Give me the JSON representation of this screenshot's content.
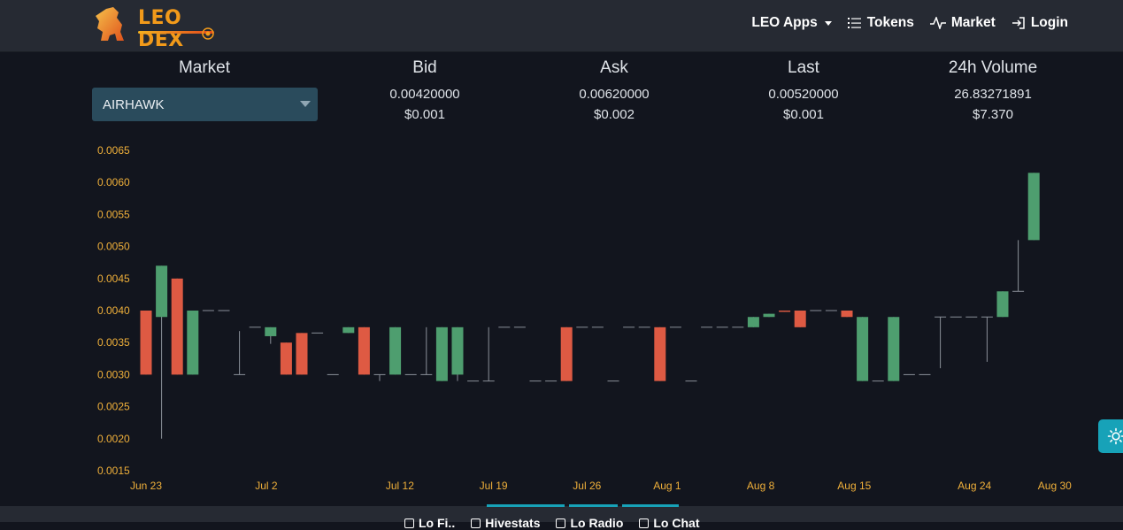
{
  "navbar": {
    "brand": "LEO DEX",
    "items": [
      {
        "label": "LEO Apps",
        "icon": "caret-down-icon"
      },
      {
        "label": "Tokens",
        "icon": "list-icon"
      },
      {
        "label": "Market",
        "icon": "activity-icon"
      },
      {
        "label": "Login",
        "icon": "login-icon"
      }
    ]
  },
  "stats": {
    "market": {
      "label": "Market",
      "selected": "AIRHAWK"
    },
    "bid": {
      "label": "Bid",
      "value": "0.00420000",
      "usd": "$0.001"
    },
    "ask": {
      "label": "Ask",
      "value": "0.00620000",
      "usd": "$0.002"
    },
    "last": {
      "label": "Last",
      "value": "0.00520000",
      "usd": "$0.001"
    },
    "volume": {
      "label": "24h Volume",
      "value": "26.83271891",
      "usd": "$7.370"
    }
  },
  "colors": {
    "up": "#4e9e6f",
    "down": "#de5a43",
    "axis_text": "#f0b03a",
    "accent": "#17a2b8"
  },
  "chart_data": {
    "type": "candlestick",
    "ylim": [
      0.0015,
      0.0065
    ],
    "y_ticks": [
      "0.0065",
      "0.0060",
      "0.0055",
      "0.0050",
      "0.0045",
      "0.0040",
      "0.0035",
      "0.0030",
      "0.0025",
      "0.0020",
      "0.0015"
    ],
    "x_ticks": [
      {
        "label": "Jun 23",
        "day": 0
      },
      {
        "label": "Jul 2",
        "day": 9
      },
      {
        "label": "Jul 12",
        "day": 19
      },
      {
        "label": "Jul 19",
        "day": 26
      },
      {
        "label": "Jul 26",
        "day": 33
      },
      {
        "label": "Aug 1",
        "day": 39
      },
      {
        "label": "Aug 8",
        "day": 46
      },
      {
        "label": "Aug 15",
        "day": 53
      },
      {
        "label": "Aug 24",
        "day": 62
      },
      {
        "label": "Aug 30",
        "day": 68
      }
    ],
    "candles": [
      {
        "date": "Jun 23",
        "open": 0.004,
        "close": 0.003,
        "high": 0.004,
        "low": 0.003
      },
      {
        "date": "Jun 24",
        "open": 0.0039,
        "close": 0.0047,
        "high": 0.0047,
        "low": 0.002
      },
      {
        "date": "Jun 25",
        "open": 0.0045,
        "close": 0.003,
        "high": 0.0045,
        "low": 0.003
      },
      {
        "date": "Jun 26",
        "open": 0.003,
        "close": 0.004,
        "high": 0.004,
        "low": 0.003
      },
      {
        "date": "Jun 27",
        "open": 0.004,
        "close": 0.004,
        "high": 0.004,
        "low": 0.004
      },
      {
        "date": "Jun 28",
        "open": 0.004,
        "close": 0.004,
        "high": 0.004,
        "low": 0.004
      },
      {
        "date": "Jun 29",
        "open": 0.003,
        "close": 0.003,
        "high": 0.00368,
        "low": 0.003
      },
      {
        "date": "Jun 30",
        "open": 0.00374,
        "close": 0.00374,
        "high": 0.00374,
        "low": 0.00374
      },
      {
        "date": "Jul 1",
        "open": 0.0036,
        "close": 0.00374,
        "high": 0.00374,
        "low": 0.00348
      },
      {
        "date": "Jul 2",
        "open": 0.0035,
        "close": 0.003,
        "high": 0.0035,
        "low": 0.003
      },
      {
        "date": "Jul 3",
        "open": 0.00365,
        "close": 0.003,
        "high": 0.00365,
        "low": 0.003
      },
      {
        "date": "Jul 4",
        "open": 0.00365,
        "close": 0.00365,
        "high": 0.00365,
        "low": 0.00365
      },
      {
        "date": "Jul 5",
        "open": 0.003,
        "close": 0.003,
        "high": 0.003,
        "low": 0.003
      },
      {
        "date": "Jul 6",
        "open": 0.00365,
        "close": 0.00374,
        "high": 0.00374,
        "low": 0.00365
      },
      {
        "date": "Jul 7",
        "open": 0.00374,
        "close": 0.003,
        "high": 0.00374,
        "low": 0.003
      },
      {
        "date": "Jul 8",
        "open": 0.003,
        "close": 0.003,
        "high": 0.003,
        "low": 0.0029
      },
      {
        "date": "Jul 9",
        "open": 0.003,
        "close": 0.00374,
        "high": 0.00374,
        "low": 0.003
      },
      {
        "date": "Jul 10",
        "open": 0.003,
        "close": 0.003,
        "high": 0.003,
        "low": 0.003
      },
      {
        "date": "Jul 11",
        "open": 0.003,
        "close": 0.003,
        "high": 0.00374,
        "low": 0.003
      },
      {
        "date": "Jul 12",
        "open": 0.0029,
        "close": 0.00374,
        "high": 0.00374,
        "low": 0.0029
      },
      {
        "date": "Jul 13",
        "open": 0.003,
        "close": 0.00374,
        "high": 0.00374,
        "low": 0.0029
      },
      {
        "date": "Jul 14",
        "open": 0.0029,
        "close": 0.0029,
        "high": 0.0029,
        "low": 0.0029
      },
      {
        "date": "Jul 15",
        "open": 0.0029,
        "close": 0.0029,
        "high": 0.00374,
        "low": 0.0029
      },
      {
        "date": "Jul 16",
        "open": 0.00374,
        "close": 0.00374,
        "high": 0.00374,
        "low": 0.00374
      },
      {
        "date": "Jul 17",
        "open": 0.00374,
        "close": 0.00374,
        "high": 0.00374,
        "low": 0.00374
      },
      {
        "date": "Jul 20",
        "open": 0.0029,
        "close": 0.0029,
        "high": 0.0029,
        "low": 0.0029
      },
      {
        "date": "Jul 21",
        "open": 0.0029,
        "close": 0.0029,
        "high": 0.0029,
        "low": 0.0029
      },
      {
        "date": "Jul 22",
        "open": 0.00374,
        "close": 0.0029,
        "high": 0.00374,
        "low": 0.0029
      },
      {
        "date": "Jul 23",
        "open": 0.00374,
        "close": 0.00374,
        "high": 0.00374,
        "low": 0.00374
      },
      {
        "date": "Jul 24",
        "open": 0.00374,
        "close": 0.00374,
        "high": 0.00374,
        "low": 0.00374
      },
      {
        "date": "Jul 26",
        "open": 0.0029,
        "close": 0.0029,
        "high": 0.0029,
        "low": 0.0029
      },
      {
        "date": "Jul 28",
        "open": 0.00374,
        "close": 0.00374,
        "high": 0.00374,
        "low": 0.00374
      },
      {
        "date": "Jul 29",
        "open": 0.00374,
        "close": 0.00374,
        "high": 0.00374,
        "low": 0.00374
      },
      {
        "date": "Jul 30",
        "open": 0.00374,
        "close": 0.0029,
        "high": 0.00374,
        "low": 0.0029
      },
      {
        "date": "Jul 31",
        "open": 0.00374,
        "close": 0.00374,
        "high": 0.00374,
        "low": 0.00374
      },
      {
        "date": "Aug 1",
        "open": 0.0029,
        "close": 0.0029,
        "high": 0.0029,
        "low": 0.0029
      },
      {
        "date": "Aug 3",
        "open": 0.00374,
        "close": 0.00374,
        "high": 0.00374,
        "low": 0.00374
      },
      {
        "date": "Aug 4",
        "open": 0.00374,
        "close": 0.00374,
        "high": 0.00374,
        "low": 0.00374
      },
      {
        "date": "Aug 5",
        "open": 0.00374,
        "close": 0.00374,
        "high": 0.00374,
        "low": 0.00374
      },
      {
        "date": "Aug 6",
        "open": 0.00374,
        "close": 0.0039,
        "high": 0.0039,
        "low": 0.00374
      },
      {
        "date": "Aug 7",
        "open": 0.0039,
        "close": 0.00395,
        "high": 0.00395,
        "low": 0.0039
      },
      {
        "date": "Aug 8",
        "open": 0.004,
        "close": 0.00398,
        "high": 0.004,
        "low": 0.00398
      },
      {
        "date": "Aug 9",
        "open": 0.004,
        "close": 0.00374,
        "high": 0.004,
        "low": 0.00374
      },
      {
        "date": "Aug 10",
        "open": 0.004,
        "close": 0.004,
        "high": 0.004,
        "low": 0.004
      },
      {
        "date": "Aug 11",
        "open": 0.004,
        "close": 0.004,
        "high": 0.004,
        "low": 0.004
      },
      {
        "date": "Aug 12",
        "open": 0.004,
        "close": 0.0039,
        "high": 0.004,
        "low": 0.0039
      },
      {
        "date": "Aug 13",
        "open": 0.0029,
        "close": 0.0039,
        "high": 0.0039,
        "low": 0.0029
      },
      {
        "date": "Aug 14",
        "open": 0.0029,
        "close": 0.0029,
        "high": 0.0029,
        "low": 0.0029
      },
      {
        "date": "Aug 15",
        "open": 0.0029,
        "close": 0.0039,
        "high": 0.0039,
        "low": 0.0029
      },
      {
        "date": "Aug 16",
        "open": 0.003,
        "close": 0.003,
        "high": 0.003,
        "low": 0.003
      },
      {
        "date": "Aug 17",
        "open": 0.003,
        "close": 0.003,
        "high": 0.003,
        "low": 0.003
      },
      {
        "date": "Aug 18",
        "open": 0.0039,
        "close": 0.0039,
        "high": 0.0039,
        "low": 0.0031
      },
      {
        "date": "Aug 19",
        "open": 0.0039,
        "close": 0.0039,
        "high": 0.0039,
        "low": 0.0039
      },
      {
        "date": "Aug 20",
        "open": 0.0039,
        "close": 0.0039,
        "high": 0.0039,
        "low": 0.0039
      },
      {
        "date": "Aug 21",
        "open": 0.0039,
        "close": 0.0039,
        "high": 0.0039,
        "low": 0.0032
      },
      {
        "date": "Aug 22",
        "open": 0.0039,
        "close": 0.0043,
        "high": 0.0043,
        "low": 0.0039
      },
      {
        "date": "Aug 23",
        "open": 0.0043,
        "close": 0.0043,
        "high": 0.0051,
        "low": 0.0043
      },
      {
        "date": "Aug 24",
        "open": 0.0051,
        "close": 0.00615,
        "high": 0.00615,
        "low": 0.0051
      }
    ]
  },
  "theme_button": {
    "icon": "sun-icon"
  },
  "bottom_tabs": [
    {
      "label": "Lo Fi..",
      "icon": "tab-icon"
    },
    {
      "label": "Hivestats",
      "icon": "tab-icon"
    },
    {
      "label": "Lo Radio",
      "icon": "tab-icon"
    },
    {
      "label": "Lo Chat",
      "icon": "tab-icon"
    }
  ]
}
